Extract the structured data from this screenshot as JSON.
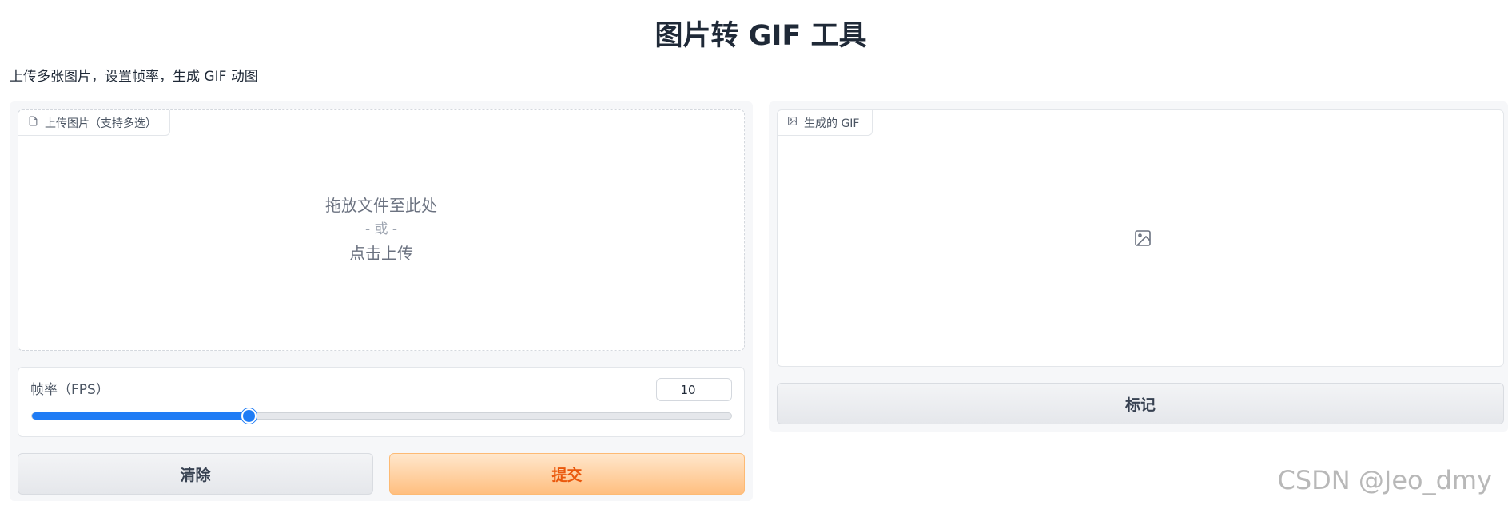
{
  "header": {
    "title": "图片转 GIF 工具",
    "description": "上传多张图片，设置帧率，生成 GIF 动图"
  },
  "upload": {
    "label": "上传图片（支持多选）",
    "icon": "file-icon",
    "drop_text": "拖放文件至此处",
    "or_text": "- 或 -",
    "click_text": "点击上传"
  },
  "slider": {
    "label": "帧率（FPS）",
    "value": "10",
    "min": 1,
    "max": 30,
    "accent": "#1f7cf5"
  },
  "buttons": {
    "clear": "清除",
    "submit": "提交",
    "flag": "标记"
  },
  "output": {
    "label": "生成的 GIF",
    "icon": "image-icon"
  },
  "watermark": "CSDN @Jeo_dmy",
  "colors": {
    "submit_text": "#ea580c",
    "submit_bg": "#ffbf80",
    "slider_accent": "#1f7cf5"
  }
}
